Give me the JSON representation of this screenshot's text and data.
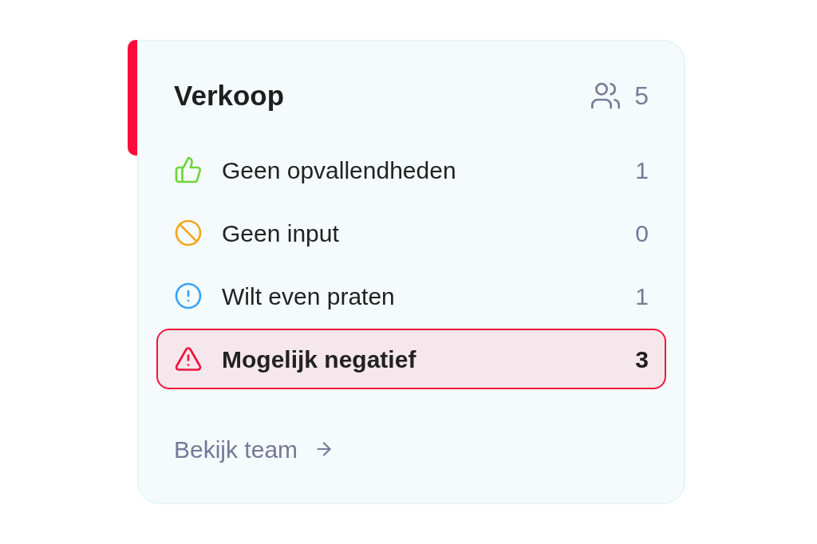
{
  "team_card": {
    "title": "Verkoop",
    "member_count": "5",
    "statuses": [
      {
        "kind": "positive",
        "label": "Geen opvallendheden",
        "count": "1",
        "selected": false
      },
      {
        "kind": "no-input",
        "label": "Geen input",
        "count": "0",
        "selected": false
      },
      {
        "kind": "info",
        "label": "Wilt even praten",
        "count": "1",
        "selected": false
      },
      {
        "kind": "warning",
        "label": "Mogelijk negatief",
        "count": "3",
        "selected": true
      }
    ],
    "link": {
      "label": "Bekijk team"
    }
  }
}
